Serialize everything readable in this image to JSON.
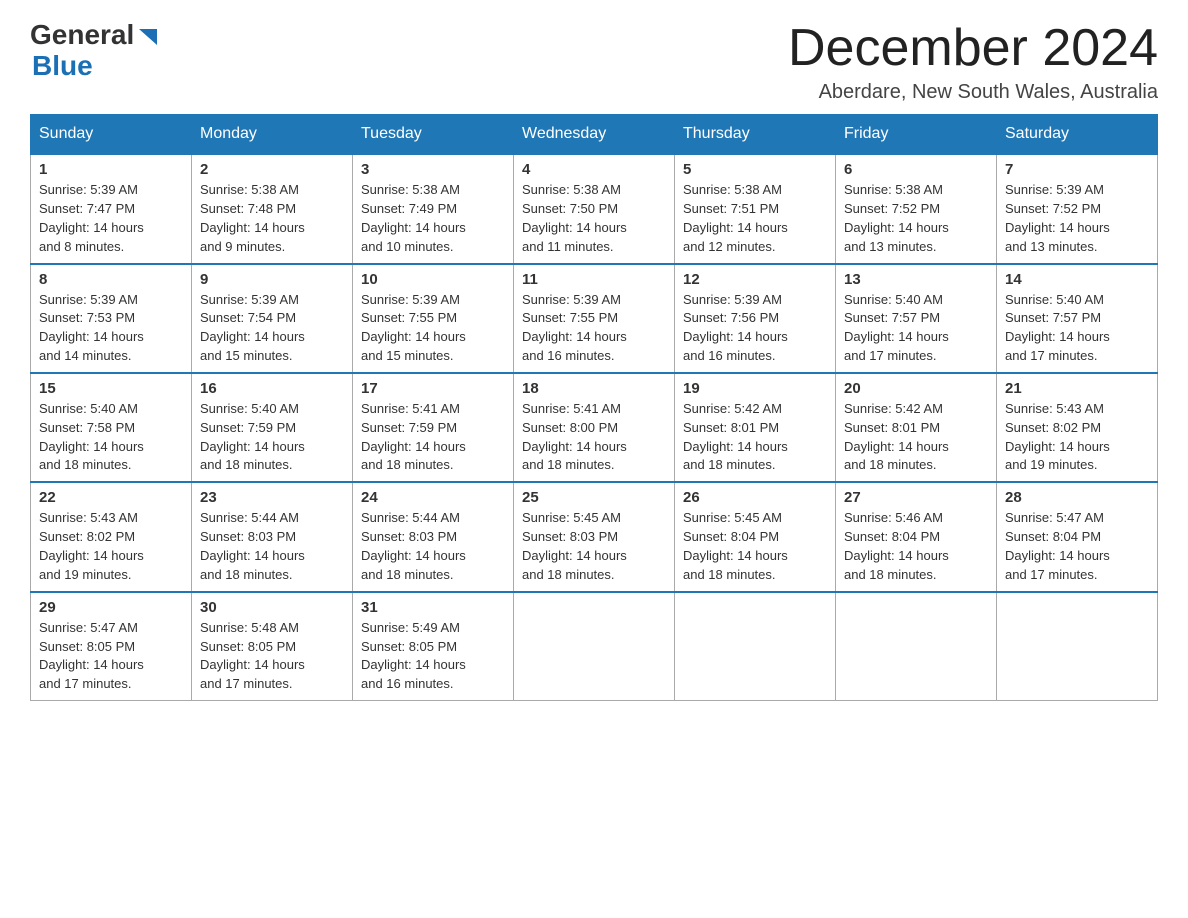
{
  "header": {
    "month_title": "December 2024",
    "location": "Aberdare, New South Wales, Australia",
    "logo_general": "General",
    "logo_blue": "Blue"
  },
  "weekdays": [
    "Sunday",
    "Monday",
    "Tuesday",
    "Wednesday",
    "Thursday",
    "Friday",
    "Saturday"
  ],
  "weeks": [
    [
      {
        "num": "1",
        "sunrise": "5:39 AM",
        "sunset": "7:47 PM",
        "daylight": "14 hours and 8 minutes."
      },
      {
        "num": "2",
        "sunrise": "5:38 AM",
        "sunset": "7:48 PM",
        "daylight": "14 hours and 9 minutes."
      },
      {
        "num": "3",
        "sunrise": "5:38 AM",
        "sunset": "7:49 PM",
        "daylight": "14 hours and 10 minutes."
      },
      {
        "num": "4",
        "sunrise": "5:38 AM",
        "sunset": "7:50 PM",
        "daylight": "14 hours and 11 minutes."
      },
      {
        "num": "5",
        "sunrise": "5:38 AM",
        "sunset": "7:51 PM",
        "daylight": "14 hours and 12 minutes."
      },
      {
        "num": "6",
        "sunrise": "5:38 AM",
        "sunset": "7:52 PM",
        "daylight": "14 hours and 13 minutes."
      },
      {
        "num": "7",
        "sunrise": "5:39 AM",
        "sunset": "7:52 PM",
        "daylight": "14 hours and 13 minutes."
      }
    ],
    [
      {
        "num": "8",
        "sunrise": "5:39 AM",
        "sunset": "7:53 PM",
        "daylight": "14 hours and 14 minutes."
      },
      {
        "num": "9",
        "sunrise": "5:39 AM",
        "sunset": "7:54 PM",
        "daylight": "14 hours and 15 minutes."
      },
      {
        "num": "10",
        "sunrise": "5:39 AM",
        "sunset": "7:55 PM",
        "daylight": "14 hours and 15 minutes."
      },
      {
        "num": "11",
        "sunrise": "5:39 AM",
        "sunset": "7:55 PM",
        "daylight": "14 hours and 16 minutes."
      },
      {
        "num": "12",
        "sunrise": "5:39 AM",
        "sunset": "7:56 PM",
        "daylight": "14 hours and 16 minutes."
      },
      {
        "num": "13",
        "sunrise": "5:40 AM",
        "sunset": "7:57 PM",
        "daylight": "14 hours and 17 minutes."
      },
      {
        "num": "14",
        "sunrise": "5:40 AM",
        "sunset": "7:57 PM",
        "daylight": "14 hours and 17 minutes."
      }
    ],
    [
      {
        "num": "15",
        "sunrise": "5:40 AM",
        "sunset": "7:58 PM",
        "daylight": "14 hours and 18 minutes."
      },
      {
        "num": "16",
        "sunrise": "5:40 AM",
        "sunset": "7:59 PM",
        "daylight": "14 hours and 18 minutes."
      },
      {
        "num": "17",
        "sunrise": "5:41 AM",
        "sunset": "7:59 PM",
        "daylight": "14 hours and 18 minutes."
      },
      {
        "num": "18",
        "sunrise": "5:41 AM",
        "sunset": "8:00 PM",
        "daylight": "14 hours and 18 minutes."
      },
      {
        "num": "19",
        "sunrise": "5:42 AM",
        "sunset": "8:01 PM",
        "daylight": "14 hours and 18 minutes."
      },
      {
        "num": "20",
        "sunrise": "5:42 AM",
        "sunset": "8:01 PM",
        "daylight": "14 hours and 18 minutes."
      },
      {
        "num": "21",
        "sunrise": "5:43 AM",
        "sunset": "8:02 PM",
        "daylight": "14 hours and 19 minutes."
      }
    ],
    [
      {
        "num": "22",
        "sunrise": "5:43 AM",
        "sunset": "8:02 PM",
        "daylight": "14 hours and 19 minutes."
      },
      {
        "num": "23",
        "sunrise": "5:44 AM",
        "sunset": "8:03 PM",
        "daylight": "14 hours and 18 minutes."
      },
      {
        "num": "24",
        "sunrise": "5:44 AM",
        "sunset": "8:03 PM",
        "daylight": "14 hours and 18 minutes."
      },
      {
        "num": "25",
        "sunrise": "5:45 AM",
        "sunset": "8:03 PM",
        "daylight": "14 hours and 18 minutes."
      },
      {
        "num": "26",
        "sunrise": "5:45 AM",
        "sunset": "8:04 PM",
        "daylight": "14 hours and 18 minutes."
      },
      {
        "num": "27",
        "sunrise": "5:46 AM",
        "sunset": "8:04 PM",
        "daylight": "14 hours and 18 minutes."
      },
      {
        "num": "28",
        "sunrise": "5:47 AM",
        "sunset": "8:04 PM",
        "daylight": "14 hours and 17 minutes."
      }
    ],
    [
      {
        "num": "29",
        "sunrise": "5:47 AM",
        "sunset": "8:05 PM",
        "daylight": "14 hours and 17 minutes."
      },
      {
        "num": "30",
        "sunrise": "5:48 AM",
        "sunset": "8:05 PM",
        "daylight": "14 hours and 17 minutes."
      },
      {
        "num": "31",
        "sunrise": "5:49 AM",
        "sunset": "8:05 PM",
        "daylight": "14 hours and 16 minutes."
      },
      null,
      null,
      null,
      null
    ]
  ],
  "labels": {
    "sunrise": "Sunrise:",
    "sunset": "Sunset:",
    "daylight": "Daylight:"
  }
}
